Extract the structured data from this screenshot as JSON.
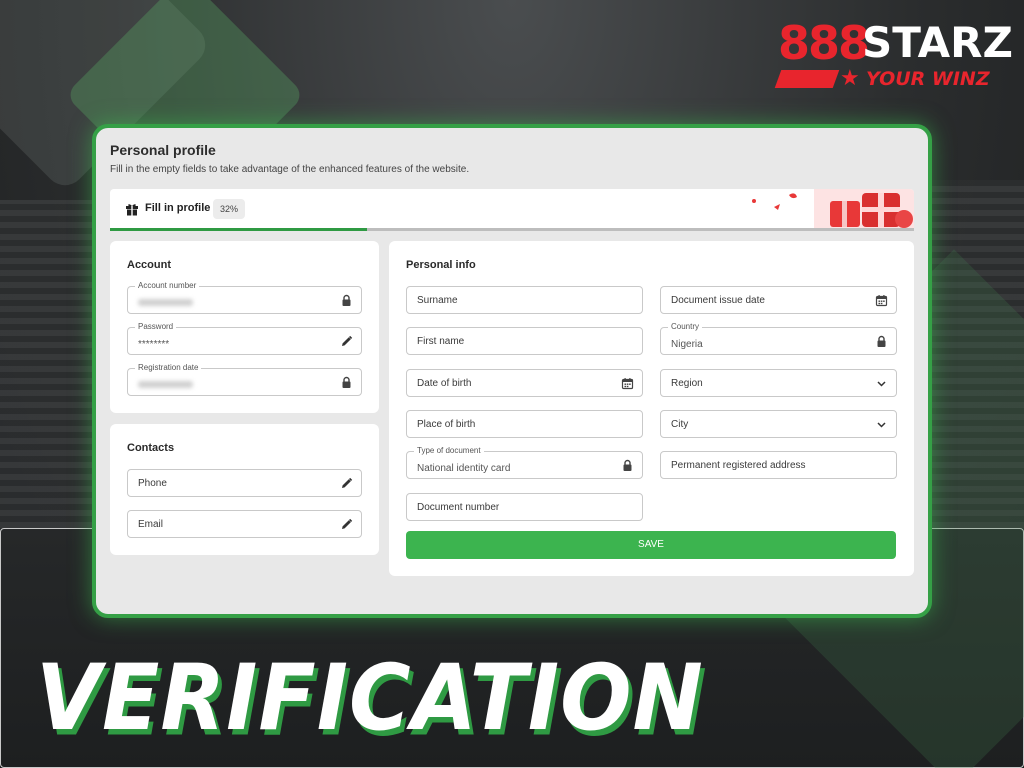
{
  "logo": {
    "digits": "888",
    "brand": "STARZ",
    "slogan": "YOUR WINZ"
  },
  "banner_title": "VERIFICATION",
  "profile": {
    "title": "Personal profile",
    "subtitle": "Fill in the empty fields to take advantage of the enhanced features of the website.",
    "fill_label": "Fill in profile",
    "fill_percent_label": "32%",
    "fill_progress": 0.32
  },
  "account": {
    "title": "Account",
    "account_number_label": "Account number",
    "password_label": "Password",
    "password_value": "********",
    "registration_date_label": "Registration date"
  },
  "contacts": {
    "title": "Contacts",
    "phone": "Phone",
    "email": "Email"
  },
  "personal_info": {
    "title": "Personal info",
    "surname": "Surname",
    "first_name": "First name",
    "date_of_birth": "Date of birth",
    "place_of_birth": "Place of birth",
    "type_of_document_label": "Type of document",
    "type_of_document_value": "National identity card",
    "document_number": "Document number",
    "document_issue_date": "Document issue date",
    "country_label": "Country",
    "country_value": "Nigeria",
    "region": "Region",
    "city": "City",
    "permanent_address": "Permanent registered address",
    "save_label": "SAVE"
  },
  "colors": {
    "accent_green": "#3cb44f",
    "brand_red": "#e8252d",
    "window_border": "#35a046"
  }
}
